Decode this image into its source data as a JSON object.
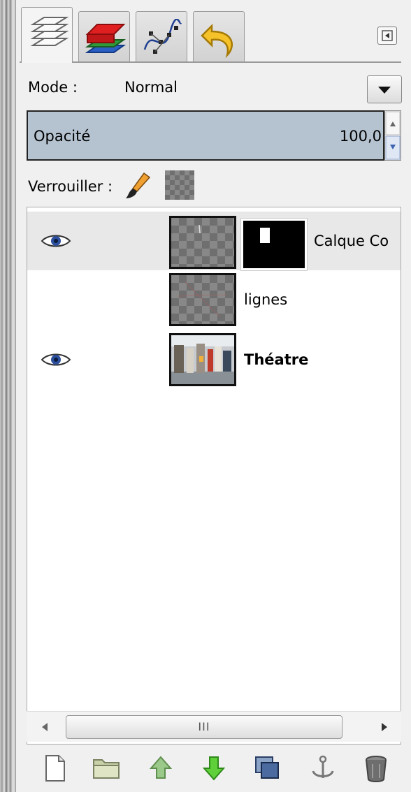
{
  "tabs": [
    {
      "name": "tab-layers",
      "icon": "layers-icon",
      "active": true
    },
    {
      "name": "tab-channels",
      "icon": "channels-icon",
      "active": false
    },
    {
      "name": "tab-paths",
      "icon": "paths-icon",
      "active": false
    },
    {
      "name": "tab-undo-history",
      "icon": "undo-icon",
      "active": false
    }
  ],
  "mode": {
    "label": "Mode :",
    "value": "Normal"
  },
  "opacity": {
    "label": "Opacité",
    "value": "100,0"
  },
  "lock": {
    "label": "Verrouiller :"
  },
  "layers": [
    {
      "name": "Calque Co",
      "visible": true,
      "has_mask": true,
      "bold": false
    },
    {
      "name": "lignes",
      "visible": false,
      "has_mask": false,
      "bold": false
    },
    {
      "name": "Théatre",
      "visible": true,
      "has_mask": false,
      "bold": true
    }
  ],
  "scrollbar": {
    "grip": "III"
  },
  "toolbar": [
    "new-layer-button",
    "new-layer-group-button",
    "raise-layer-button",
    "lower-layer-button",
    "duplicate-layer-button",
    "anchor-layer-button",
    "delete-layer-button"
  ],
  "colors": {
    "opacity_bar": "#b5c3d0",
    "selection": "#e8e8e8"
  }
}
